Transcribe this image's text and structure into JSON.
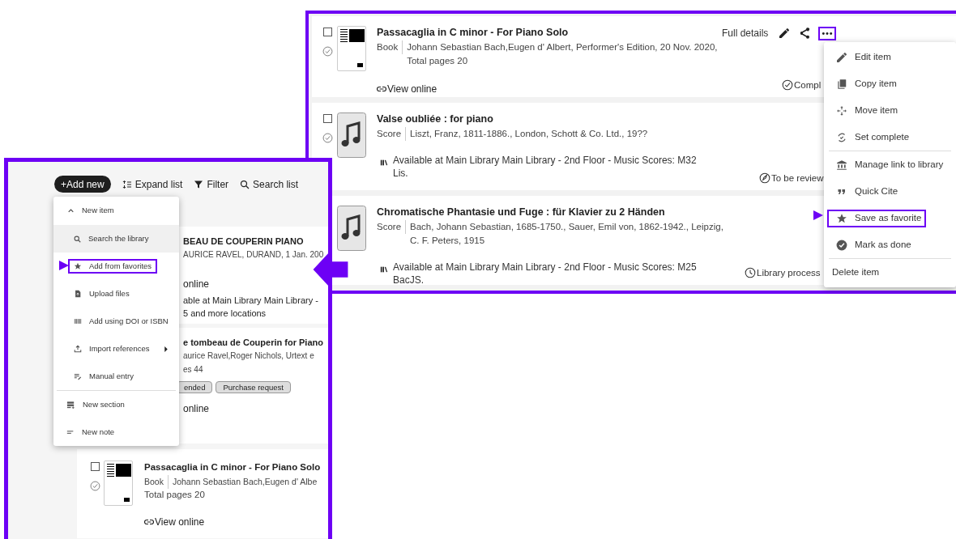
{
  "reading_list": {
    "items": [
      {
        "kind": "cover",
        "checkbox": {
          "checked": false
        },
        "title": "Passacaglia in C minor - For Piano Solo",
        "type": "Book",
        "details": "Johann Sebastian Bach,Eugen d' Albert, Performer's Edition, 20 Nov. 2020, Total pages 20",
        "link": "View online",
        "status": {
          "kind": "complete",
          "label": "Compl"
        },
        "actions": {
          "full_details": "Full details",
          "more_selected": true
        }
      },
      {
        "kind": "score",
        "checkbox": {
          "checked": false
        },
        "title": "Valse oubliée : for piano",
        "type": "Score",
        "details": "Liszt, Franz, 1811-1886., London, Schott & Co. Ltd., 19??",
        "availability": "Available at Main Library Main Library - 2nd Floor - Music Scores: M32 Lis.",
        "status": {
          "kind": "review",
          "label": "To be review"
        }
      },
      {
        "kind": "score",
        "title": "Chromatische Phantasie und Fuge : für Klavier zu 2 Händen",
        "type": "Score",
        "details": "Bach, Johann Sebastian, 1685-1750., Sauer, Emil von, 1862-1942., Leipzig, C. F. Peters, 1915",
        "availability": "Available at Main Library Main Library - 2nd Floor - Music Scores: M25 BacJS.",
        "status": {
          "kind": "processing",
          "label": "Library process"
        }
      }
    ]
  },
  "item_menu": {
    "groups": [
      [
        {
          "label": "Edit item",
          "selected": false
        },
        {
          "label": "Copy item",
          "selected": false
        },
        {
          "label": "Move item",
          "selected": false
        },
        {
          "label": "Set complete",
          "selected": false
        }
      ],
      [
        {
          "label": "Manage link to library",
          "selected": false
        },
        {
          "label": "Quick Cite",
          "selected": false
        },
        {
          "label": "Save as favorite",
          "selected": true
        },
        {
          "label": "Mark as done",
          "selected": false
        }
      ],
      [
        {
          "label": "Delete item",
          "selected": false
        }
      ]
    ]
  },
  "list_view": {
    "toolbar": {
      "add_new": "+Add new",
      "buttons": [
        "Expand list",
        "Filter",
        "Search list"
      ]
    },
    "cards": [
      {
        "title": "BEAU DE COUPERIN PIANO",
        "details": [
          "AURICE RAVEL, DURAND, 1 Jan. 200"
        ],
        "link": "online",
        "availability": [
          "able at Main Library Main Library -",
          "5 and more locations"
        ]
      },
      {
        "title": "e tombeau de Couperin for Piano",
        "details": [
          "aurice Ravel,Roger Nichols, Urtext e",
          "es 44"
        ],
        "tags": [
          "ended",
          "Purchase request"
        ],
        "link": "online"
      }
    ],
    "full_card": {
      "checkbox": {
        "checked": false
      },
      "title": "Passacaglia in C minor - For Piano Solo",
      "type": "Book",
      "details": "Johann Sebastian Bach,Eugen d' Albe",
      "extra": "Total pages 20",
      "link": "View online"
    },
    "add_menu": {
      "header": {
        "label": "New item",
        "expanded": true
      },
      "items": [
        {
          "label": "Search the library",
          "hovered": true,
          "selected": false
        },
        {
          "label": "Add from favorites",
          "hovered": false,
          "selected": true
        },
        {
          "label": "Upload files",
          "hovered": false,
          "selected": false
        },
        {
          "label": "Add using DOI or ISBN",
          "hovered": false,
          "selected": false
        },
        {
          "label": "Import references",
          "hovered": false,
          "selected": false,
          "submenu": true
        },
        {
          "label": "Manual entry",
          "hovered": false,
          "selected": false
        }
      ],
      "extra": [
        {
          "label": "New section"
        },
        {
          "label": "New note"
        }
      ]
    }
  }
}
